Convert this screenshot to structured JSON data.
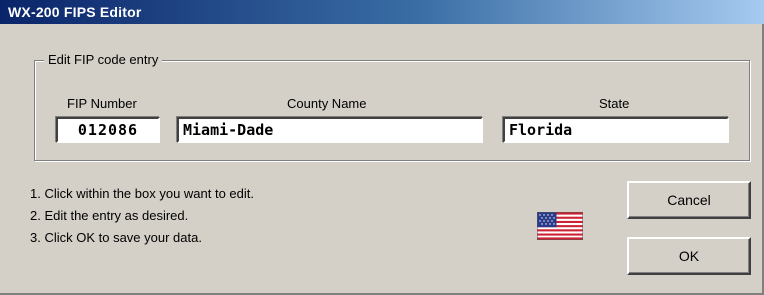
{
  "window": {
    "title": "WX-200 FIPS Editor"
  },
  "group": {
    "legend": "Edit FIP code entry",
    "columns": {
      "fip_number": "FIP Number",
      "county_name": "County Name",
      "state": "State"
    },
    "values": {
      "fip_number": "012086",
      "county_name": "Miami-Dade",
      "state": "Florida"
    }
  },
  "instructions": [
    "1.  Click within the box you want to edit.",
    "2.  Edit the entry as desired.",
    "3.  Click OK to save your data."
  ],
  "buttons": {
    "cancel": "Cancel",
    "ok": "OK"
  },
  "icons": {
    "flag": "us-flag-icon"
  },
  "colors": {
    "title_start": "#0a246a",
    "title_end": "#a6caf0",
    "face": "#d4d0c8",
    "flag_red": "#cc2233",
    "flag_blue": "#2a3a8a"
  }
}
